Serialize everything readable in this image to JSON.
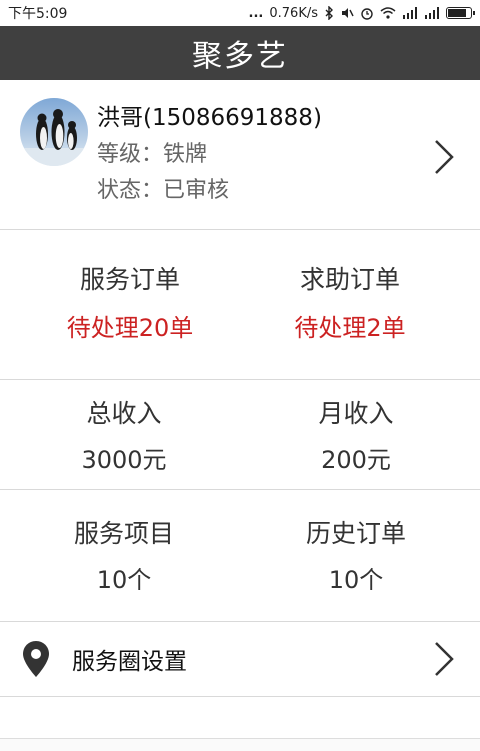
{
  "status_bar": {
    "time": "下午5:09",
    "dots": "...",
    "speed": "0.76K/s",
    "battery_level": 0.75
  },
  "header": {
    "title": "聚多艺"
  },
  "profile": {
    "name": "洪哥(15086691888)",
    "level": "等级：铁牌",
    "status": "状态：已审核"
  },
  "stats": {
    "service_orders": {
      "label": "服务订单",
      "value": "待处理20单"
    },
    "help_orders": {
      "label": "求助订单",
      "value": "待处理2单"
    },
    "total_income": {
      "label": "总收入",
      "value": "3000元"
    },
    "monthly_income": {
      "label": "月收入",
      "value": "200元"
    },
    "service_items": {
      "label": "服务项目",
      "value": "10个"
    },
    "history_orders": {
      "label": "历史订单",
      "value": "10个"
    }
  },
  "settings": {
    "service_circle": "服务圈设置"
  },
  "colors": {
    "header_bg": "#404040",
    "accent_red": "#cc2222"
  }
}
